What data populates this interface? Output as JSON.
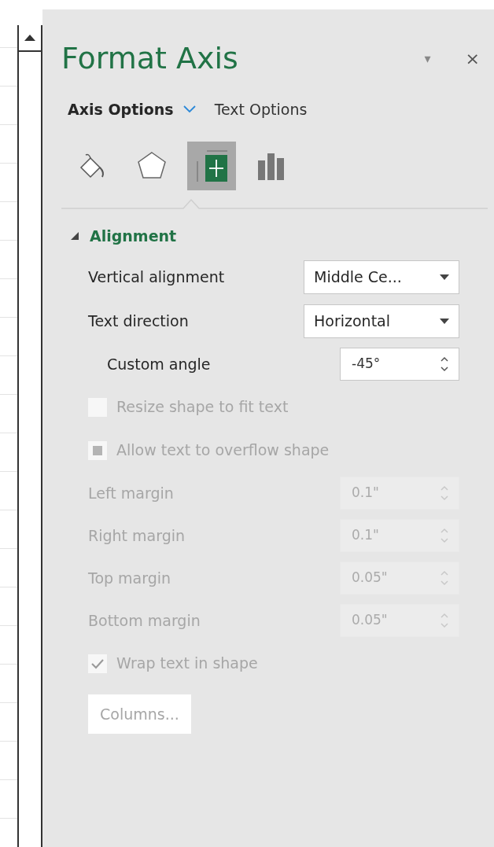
{
  "pane": {
    "title": "Format Axis",
    "menu": "▾",
    "close": "×"
  },
  "tabs": [
    {
      "label": "Axis Options",
      "selected": true,
      "has_menu": true
    },
    {
      "label": "Text Options",
      "selected": false,
      "has_menu": false
    }
  ],
  "icons": [
    {
      "kind": "fill",
      "selected": false
    },
    {
      "kind": "effects",
      "selected": false
    },
    {
      "kind": "size",
      "selected": true
    },
    {
      "kind": "axis",
      "selected": false
    }
  ],
  "section": {
    "title": "Alignment",
    "expanded": true
  },
  "rows": [
    {
      "kind": "dropdown",
      "label": "Vertical alignment",
      "value": "Middle Ce...",
      "disabled": false
    },
    {
      "kind": "dropdown",
      "label": "Text direction",
      "value": "Horizontal",
      "disabled": false
    },
    {
      "kind": "subspinner",
      "label": "Custom angle",
      "value": "-45°",
      "disabled": false
    },
    {
      "kind": "checkbox",
      "label": "Resize shape to fit text",
      "checked": false,
      "disabled": true
    },
    {
      "kind": "mixedcheckbox",
      "label": "Allow text to overflow shape",
      "checked": true,
      "disabled": true
    },
    {
      "kind": "spinner",
      "label": "Left margin",
      "value": "0.1\"",
      "disabled": true
    },
    {
      "kind": "spinner",
      "label": "Right margin",
      "value": "0.1\"",
      "disabled": true
    },
    {
      "kind": "spinner",
      "label": "Top margin",
      "value": "0.05\"",
      "disabled": true
    },
    {
      "kind": "spinner",
      "label": "Bottom margin",
      "value": "0.05\"",
      "disabled": true
    },
    {
      "kind": "checkbox",
      "label": "Wrap text in shape",
      "checked": true,
      "disabled": true
    },
    {
      "kind": "button",
      "label": "Columns...",
      "disabled": true
    }
  ]
}
